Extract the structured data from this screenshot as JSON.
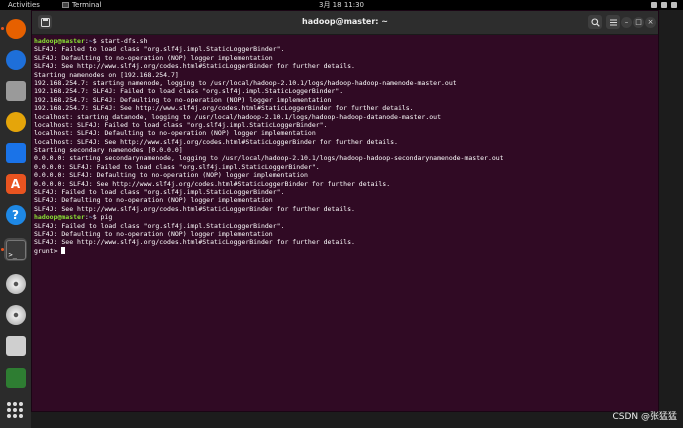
{
  "topbar": {
    "activities": "Activities",
    "app_name": "Terminal",
    "clock": "3月 18  11:30"
  },
  "window": {
    "title": "hadoop@master: ~",
    "minimize": "–",
    "maximize": "□",
    "close": "×"
  },
  "terminal": {
    "lines": [
      {
        "type": "prompt",
        "user": "hadoop@master",
        "path": "~",
        "cmd": " start-dfs.sh"
      },
      {
        "type": "out",
        "text": "SLF4J: Failed to load class \"org.slf4j.impl.StaticLoggerBinder\"."
      },
      {
        "type": "out",
        "text": "SLF4J: Defaulting to no-operation (NOP) logger implementation"
      },
      {
        "type": "out",
        "text": "SLF4J: See http://www.slf4j.org/codes.html#StaticLoggerBinder for further details."
      },
      {
        "type": "out",
        "text": "Starting namenodes on [192.168.254.7]"
      },
      {
        "type": "out",
        "text": "192.168.254.7: starting namenode, logging to /usr/local/hadoop-2.10.1/logs/hadoop-hadoop-namenode-master.out"
      },
      {
        "type": "out",
        "text": "192.168.254.7: SLF4J: Failed to load class \"org.slf4j.impl.StaticLoggerBinder\"."
      },
      {
        "type": "out",
        "text": "192.168.254.7: SLF4J: Defaulting to no-operation (NOP) logger implementation"
      },
      {
        "type": "out",
        "text": "192.168.254.7: SLF4J: See http://www.slf4j.org/codes.html#StaticLoggerBinder for further details."
      },
      {
        "type": "out",
        "text": "localhost: starting datanode, logging to /usr/local/hadoop-2.10.1/logs/hadoop-hadoop-datanode-master.out"
      },
      {
        "type": "out",
        "text": "localhost: SLF4J: Failed to load class \"org.slf4j.impl.StaticLoggerBinder\"."
      },
      {
        "type": "out",
        "text": "localhost: SLF4J: Defaulting to no-operation (NOP) logger implementation"
      },
      {
        "type": "out",
        "text": "localhost: SLF4J: See http://www.slf4j.org/codes.html#StaticLoggerBinder for further details."
      },
      {
        "type": "out",
        "text": "Starting secondary namenodes [0.0.0.0]"
      },
      {
        "type": "out",
        "text": "0.0.0.0: starting secondarynamenode, logging to /usr/local/hadoop-2.10.1/logs/hadoop-hadoop-secondarynamenode-master.out"
      },
      {
        "type": "out",
        "text": "0.0.0.0: SLF4J: Failed to load class \"org.slf4j.impl.StaticLoggerBinder\"."
      },
      {
        "type": "out",
        "text": "0.0.0.0: SLF4J: Defaulting to no-operation (NOP) logger implementation"
      },
      {
        "type": "out",
        "text": "0.0.0.0: SLF4J: See http://www.slf4j.org/codes.html#StaticLoggerBinder for further details."
      },
      {
        "type": "out",
        "text": "SLF4J: Failed to load class \"org.slf4j.impl.StaticLoggerBinder\"."
      },
      {
        "type": "out",
        "text": "SLF4J: Defaulting to no-operation (NOP) logger implementation"
      },
      {
        "type": "out",
        "text": "SLF4J: See http://www.slf4j.org/codes.html#StaticLoggerBinder for further details."
      },
      {
        "type": "prompt",
        "user": "hadoop@master",
        "path": "~",
        "cmd": " pig"
      },
      {
        "type": "out",
        "text": "SLF4J: Failed to load class \"org.slf4j.impl.StaticLoggerBinder\"."
      },
      {
        "type": "out",
        "text": "SLF4J: Defaulting to no-operation (NOP) logger implementation"
      },
      {
        "type": "out",
        "text": "SLF4J: See http://www.slf4j.org/codes.html#StaticLoggerBinder for further details."
      },
      {
        "type": "cursor",
        "text": "grunt> "
      }
    ]
  },
  "dock": {
    "items": [
      {
        "name": "firefox-icon",
        "color": "#e66000"
      },
      {
        "name": "thunderbird-icon",
        "color": "#1e6fd9"
      },
      {
        "name": "files-icon",
        "color": "#9a9a9a"
      },
      {
        "name": "rhythmbox-icon",
        "color": "#e5a50a"
      },
      {
        "name": "writer-icon",
        "color": "#1a73e8"
      },
      {
        "name": "app-center-icon",
        "color": "#e95420"
      },
      {
        "name": "help-icon",
        "color": "#1e88e5"
      },
      {
        "name": "terminal-icon",
        "color": "#3a3a3a"
      },
      {
        "name": "disc-icon",
        "color": "#d0d0d0"
      },
      {
        "name": "disc-icon",
        "color": "#d0d0d0"
      },
      {
        "name": "save-disk-icon",
        "color": "#cfcfcf"
      },
      {
        "name": "trash-icon",
        "color": "#2e7d32"
      }
    ]
  },
  "watermark": "CSDN @张猛猛"
}
